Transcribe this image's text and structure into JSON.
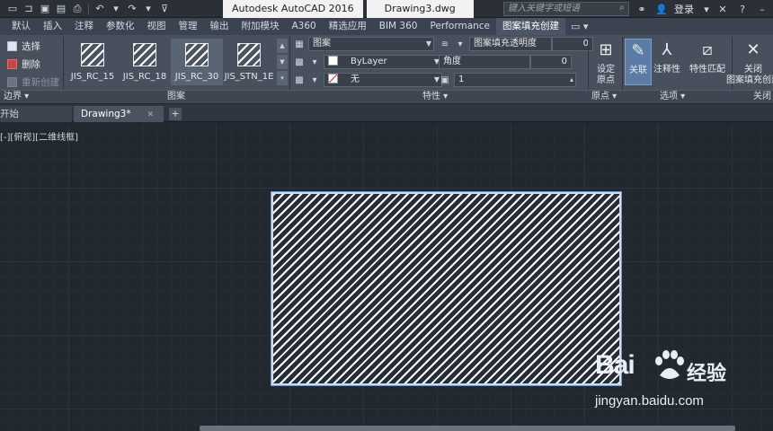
{
  "titlebar": {
    "app_name": "Autodesk AutoCAD 2016",
    "doc_name": "Drawing3.dwg",
    "search_placeholder": "键入关键字或短语",
    "login_label": "登录"
  },
  "tabs": [
    {
      "label": "默认"
    },
    {
      "label": "插入"
    },
    {
      "label": "注释"
    },
    {
      "label": "参数化"
    },
    {
      "label": "视图"
    },
    {
      "label": "管理"
    },
    {
      "label": "输出"
    },
    {
      "label": "附加模块"
    },
    {
      "label": "A360"
    },
    {
      "label": "精选应用"
    },
    {
      "label": "BIM 360"
    },
    {
      "label": "Performance"
    },
    {
      "label": "图案填充创建",
      "active": true
    }
  ],
  "boundary": {
    "title": "边界",
    "pick_label": "选择",
    "remove_label": "删除",
    "recreate_label": "重新创建"
  },
  "pattern": {
    "title": "图案",
    "swatches": [
      {
        "label": "JIS_RC_15"
      },
      {
        "label": "JIS_RC_18"
      },
      {
        "label": "JIS_RC_30",
        "selected": true
      },
      {
        "label": "JIS_STN_1E"
      }
    ]
  },
  "properties": {
    "title": "特性",
    "pattern_type": "图案",
    "color": "ByLayer",
    "background": "无",
    "transparency_label": "图案填充透明度",
    "transparency_value": "0",
    "angle_label": "角度",
    "angle_value": "0",
    "scale_value": "1"
  },
  "origin": {
    "title": "原点",
    "set_origin_label": "设定\n原点"
  },
  "options": {
    "title": "选项",
    "associative_label": "关联",
    "annotative_label": "注释性",
    "match_label": "特性匹配"
  },
  "close": {
    "title": "关闭",
    "close_label": "关闭\n图案填充创建"
  },
  "doc_tabs": {
    "start_label": "开始",
    "drawing_label": "Drawing3*"
  },
  "viewport": {
    "label": "[-][俯视][二维线框]"
  },
  "watermark": {
    "brand": "Bai",
    "brand_cn": "经验",
    "url": "jingyan.baidu.com"
  },
  "colors": {
    "canvas_bg": "#212830",
    "hatch_line": "#ffffff",
    "selection": "#6a9be0",
    "ribbon_bg": "#47505c"
  }
}
